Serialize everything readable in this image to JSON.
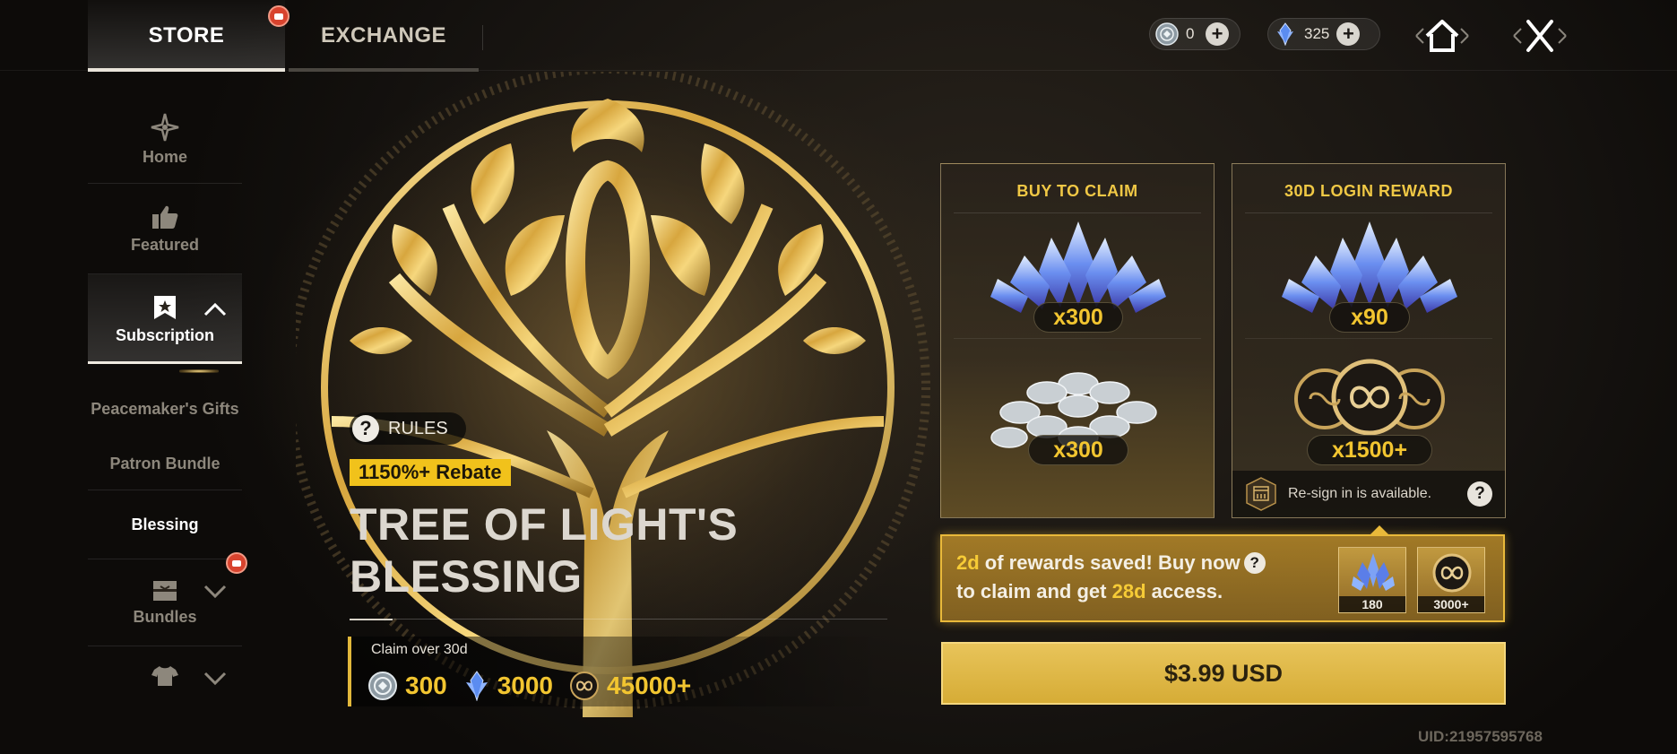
{
  "tabs": [
    {
      "label": "STORE",
      "active": true,
      "has_badge": true
    },
    {
      "label": "EXCHANGE",
      "active": false
    }
  ],
  "currencies": {
    "silver_coin": {
      "icon": "silver-coin-icon",
      "value": "0"
    },
    "crystal": {
      "icon": "blue-crystal-icon",
      "value": "325"
    }
  },
  "sidebar": {
    "home": "Home",
    "featured": "Featured",
    "subscription": "Subscription",
    "sub_items": [
      "Peacemaker's Gifts",
      "Patron Bundle",
      "Blessing"
    ],
    "bundles": "Bundles"
  },
  "hero": {
    "rules_label": "RULES",
    "rebate": "1150%+ Rebate",
    "title_line1": "TREE OF LIGHT'S",
    "title_line2": "BLESSING",
    "claim_label": "Claim over 30d",
    "claim_values": [
      "300",
      "3000",
      "45000+"
    ]
  },
  "cards": {
    "buy": {
      "title": "BUY TO CLAIM",
      "crystal_qty": "x300",
      "coin_qty": "x300"
    },
    "login": {
      "title": "30D LOGIN REWARD",
      "crystal_qty": "x90",
      "token_qty": "x1500+",
      "resign_text": "Re-sign in is available."
    }
  },
  "saved_banner": {
    "days_saved": "2d",
    "text1": " of rewards saved! Buy now",
    "text2": "to claim and get ",
    "access_days": "28d",
    "text3": " access.",
    "mini_crystal": "180",
    "mini_token": "3000+"
  },
  "buy_button": "$3.99 USD",
  "uid": "UID:21957595768",
  "colors": {
    "gold": "#f2c530",
    "badge_red": "#d8432e",
    "button_gold": "#d6ac36"
  }
}
